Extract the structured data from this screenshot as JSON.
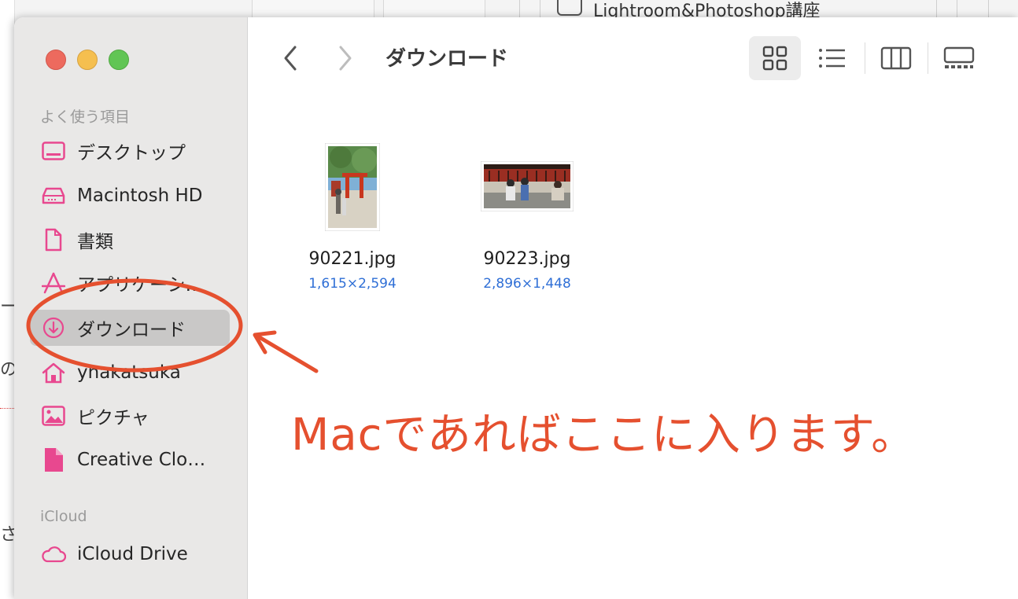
{
  "background": {
    "window_title": "Lightroom&Photoshop講座",
    "edge_glyphs": [
      "ー",
      "の",
      "さ"
    ]
  },
  "window_controls": {
    "close": "close",
    "minimize": "minimize",
    "zoom": "zoom"
  },
  "sidebar": {
    "favorites_title": "よく使う項目",
    "items": [
      {
        "label": "デスクトップ",
        "icon": "desktop-icon"
      },
      {
        "label": "Macintosh HD",
        "icon": "hard-drive-icon"
      },
      {
        "label": "書類",
        "icon": "document-icon"
      },
      {
        "label": "アプリケーシ…",
        "icon": "applications-icon"
      },
      {
        "label": "ダウンロード",
        "icon": "download-icon",
        "selected": true
      },
      {
        "label": "ynakatsuka",
        "icon": "home-icon"
      },
      {
        "label": "ピクチャ",
        "icon": "pictures-icon"
      },
      {
        "label": "Creative Clo…",
        "icon": "creative-cloud-file-icon"
      }
    ],
    "icloud_title": "iCloud",
    "icloud_items": [
      {
        "label": "iCloud Drive",
        "icon": "cloud-icon"
      }
    ],
    "icon_color": "#e8488f"
  },
  "toolbar": {
    "title": "ダウンロード",
    "back_icon": "chevron-left-icon",
    "forward_icon": "chevron-right-icon",
    "views": [
      "icon-view",
      "list-view",
      "column-view",
      "gallery-view"
    ],
    "active_view": "icon-view"
  },
  "files": [
    {
      "name": "90221.jpg",
      "dimensions": "1,615×2,594",
      "orientation": "portrait"
    },
    {
      "name": "90223.jpg",
      "dimensions": "2,896×1,448",
      "orientation": "landscape"
    }
  ],
  "annotation": {
    "text": "Macであればここに入ります。",
    "color": "#e5502f"
  }
}
